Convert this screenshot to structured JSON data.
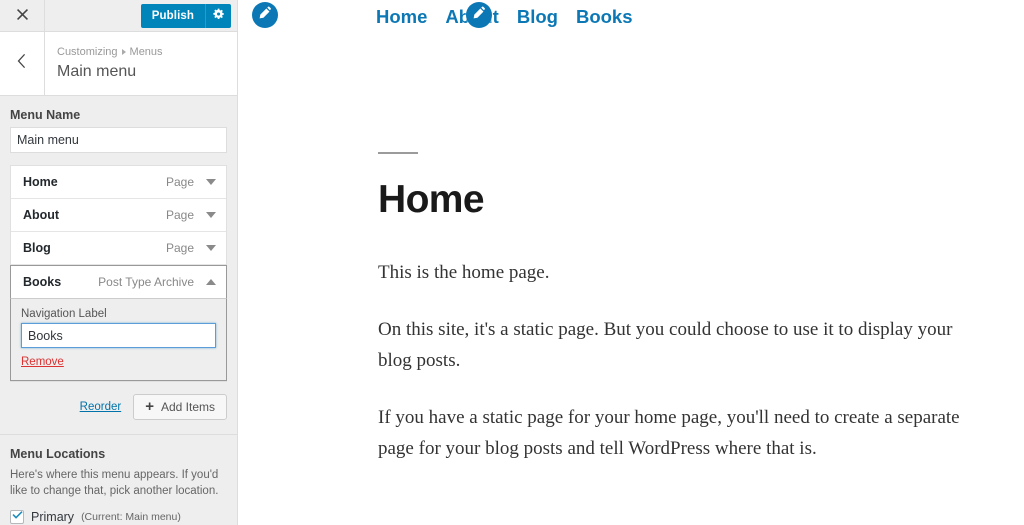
{
  "customizer": {
    "close_icon": "close-icon",
    "publish_label": "Publish",
    "gear_icon": "gear-icon",
    "back_icon": "chevron-left-icon",
    "breadcrumb_root": "Customizing",
    "breadcrumb_section": "Menus",
    "panel_title": "Main menu",
    "menu_name_label": "Menu Name",
    "menu_name_value": "Main menu",
    "menu_items": [
      {
        "title": "Home",
        "type": "Page",
        "expanded": false
      },
      {
        "title": "About",
        "type": "Page",
        "expanded": false
      },
      {
        "title": "Blog",
        "type": "Page",
        "expanded": false
      },
      {
        "title": "Books",
        "type": "Post Type Archive",
        "expanded": true
      }
    ],
    "item_settings": {
      "nav_label_label": "Navigation Label",
      "nav_label_value": "Books",
      "remove_label": "Remove"
    },
    "reorder_label": "Reorder",
    "add_items_label": "Add Items",
    "locations": {
      "title": "Menu Locations",
      "description": "Here's where this menu appears. If you'd like to change that, pick another location.",
      "checkbox_label": "Primary",
      "checkbox_current": "(Current: Main menu)",
      "checked": true
    },
    "accent_color": "#0085ba"
  },
  "preview": {
    "nav": [
      {
        "label": "Home"
      },
      {
        "label": "About"
      },
      {
        "label": "Blog"
      },
      {
        "label": "Books"
      }
    ],
    "edit_shortcuts": [
      {
        "name": "edit-shortcut-home-nav",
        "icon": "pencil-icon"
      },
      {
        "name": "edit-shortcut-books-nav",
        "icon": "pencil-icon"
      }
    ],
    "page_title": "Home",
    "paragraphs": [
      "This is the home page.",
      "On this site, it's a static page. But you could choose to use it to display your blog posts.",
      "If you have a static page for your home page, you'll need to create a separate page for your blog posts and tell WordPress where that is."
    ],
    "link_color": "#0b78b5"
  }
}
